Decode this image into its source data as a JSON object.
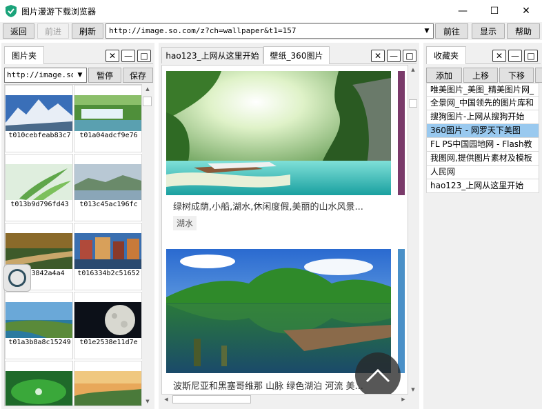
{
  "window": {
    "title": "图片漫游下载浏览器",
    "minimize": "—",
    "maximize": "☐",
    "close": "✕"
  },
  "toolbar": {
    "back": "返回",
    "forward": "前进",
    "refresh": "刷新",
    "url": "http://image.so.com/z?ch=wallpaper&t1=157",
    "go": "前往",
    "show": "显示",
    "help": "帮助"
  },
  "left_panel": {
    "tab": "图片夹",
    "combo_value": "http://image.so",
    "pause": "暂停",
    "save": "保存",
    "thumbnails": [
      {
        "label": "t010cebfeab83c7"
      },
      {
        "label": "t01a04adcf9e76"
      },
      {
        "label": "t013b9d796fd43"
      },
      {
        "label": "t013c45ac196fc"
      },
      {
        "label": "t0123842a4a4"
      },
      {
        "label": "t016334b2c51652"
      },
      {
        "label": "t01a3b8a8c15249"
      },
      {
        "label": "t01e2538e11d7e"
      },
      {
        "label": ""
      },
      {
        "label": ""
      }
    ]
  },
  "middle_panel": {
    "tabs": [
      "hao123_上网从这里开始",
      "壁纸_360图片"
    ],
    "cards": [
      {
        "title": "绿树成荫,小船,湖水,休闲度假,美丽的山水风景...",
        "tag": "湖水"
      },
      {
        "title": "波斯尼亚和黑塞哥维那 山脉 绿色湖泊 河流 美..."
      }
    ]
  },
  "right_panel": {
    "tab": "收藏夹",
    "add": "添加",
    "up": "上移",
    "down": "下移",
    "items": [
      "唯美图片_美图_精美图片网_",
      "全景网_中国领先的图片库和",
      "搜狗图片-上网从搜狗开始",
      "360图片 - 网罗天下美图",
      "FL PS中国园地网 - Flash教",
      "我图网,提供图片素材及模板",
      "人民网",
      "hao123_上网从这里开始"
    ],
    "selected_index": 3
  }
}
